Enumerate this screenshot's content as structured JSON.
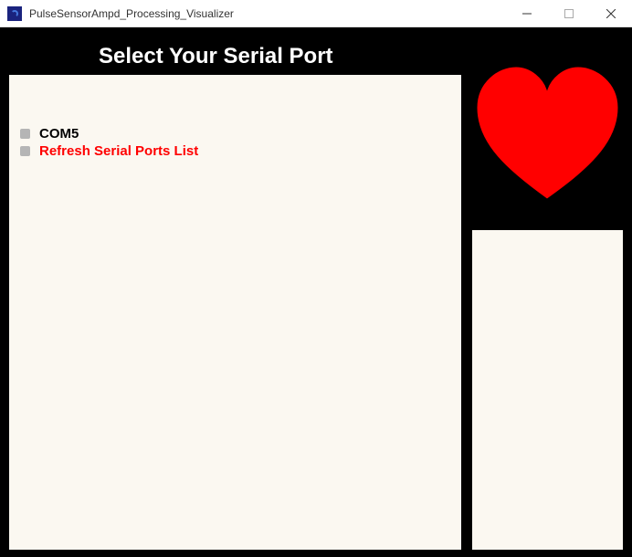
{
  "window": {
    "title": "PulseSensorAmpd_Processing_Visualizer"
  },
  "heading": "Select Your Serial Port",
  "ports": {
    "items": [
      {
        "label": "COM5",
        "kind": "port"
      },
      {
        "label": "Refresh Serial Ports List",
        "kind": "action"
      }
    ]
  },
  "colors": {
    "heart": "#ff0000",
    "bg": "#000000",
    "panel": "#fbf8f1"
  }
}
